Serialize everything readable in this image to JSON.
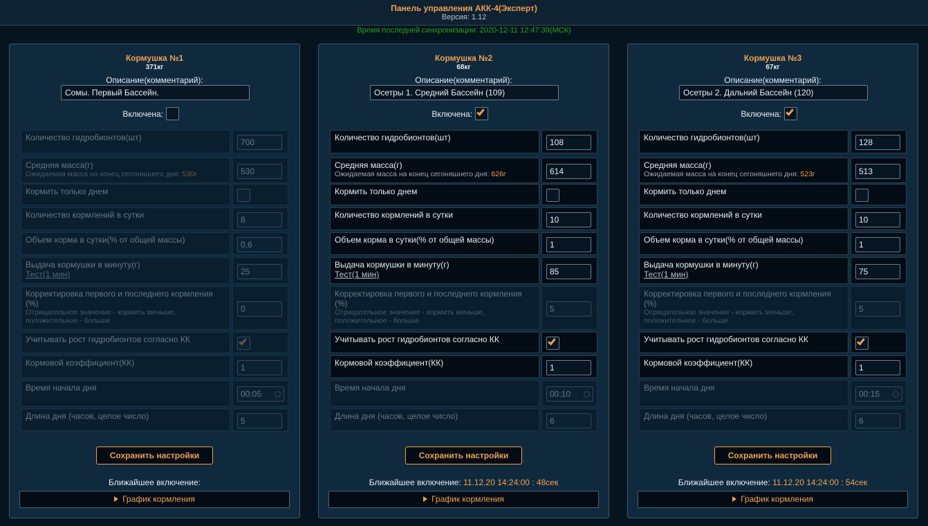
{
  "header": {
    "title": "Панель управления АКК-4(Эксперт)",
    "version": "Версия: 1.12",
    "sync": "Время последней синхронизации: 2020-12-11 12:47:39(МСК)"
  },
  "labels": {
    "description": "Описание(комментарий):",
    "enabled": "Включена:",
    "count": "Количество гидробионтов(шт)",
    "avg_mass": "Средняя масса(г)",
    "expected_mass": "Ожидаемая масса на конец сегоняшнего дня:",
    "day_only": "Кормить только днем",
    "feedings_per_day": "Количество кормлений в сутки",
    "feed_volume": "Объем корма в сутки(% от общей массы)",
    "output_per_minute": "Выдача кормушки в минуту(г)",
    "test_link": "Тест(1 мин)",
    "correction": "Корректировка первого и последнего кормления (%)",
    "correction_note": "Отрицательное значение - кормить меньше, положительное - больше",
    "growth": "Учитывать рост гидробионтов согласно КК",
    "feed_coef": "Кормовой коэффициент(КК)",
    "day_start": "Время начала дня",
    "day_length": "Длина дня (часов, целое число)",
    "save": "Сохранить настройки",
    "next_on": "Ближайшее включение:",
    "schedule": "График кормления"
  },
  "feeders": [
    {
      "name": "Кормушка №1",
      "mass": "371кг",
      "description": "Сомы. Первый Бассейн.",
      "enabled": false,
      "count": "700",
      "avg_mass": "530",
      "expected_mass": "530г",
      "day_only": false,
      "feedings_per_day": "8",
      "feed_volume": "0,6",
      "output_per_minute": "25",
      "correction": "0",
      "growth": true,
      "feed_coef": "1",
      "day_start": "00:05",
      "day_length": "5",
      "next_on": ""
    },
    {
      "name": "Кормушка №2",
      "mass": "68кг",
      "description": "Осетры 1. Средний Бассейн (109)",
      "enabled": true,
      "count": "108",
      "avg_mass": "614",
      "expected_mass": "626г",
      "day_only": false,
      "feedings_per_day": "10",
      "feed_volume": "1",
      "output_per_minute": "85",
      "correction": "5",
      "growth": true,
      "feed_coef": "1",
      "day_start": "00:10",
      "day_length": "6",
      "next_on": "11.12.20 14:24:00 : 48сек"
    },
    {
      "name": "Кормушка №3",
      "mass": "67кг",
      "description": "Осетры 2. Дальний Бассейн (120)",
      "enabled": true,
      "count": "128",
      "avg_mass": "513",
      "expected_mass": "523г",
      "day_only": false,
      "feedings_per_day": "10",
      "feed_volume": "1",
      "output_per_minute": "75",
      "correction": "5",
      "growth": true,
      "feed_coef": "1",
      "day_start": "00:15",
      "day_length": "6",
      "next_on": "11.12.20 14:24:00 : 54сек"
    }
  ],
  "colors": {
    "accent": "#f0a050",
    "background": "#06141f",
    "panel": "#0f2a3d",
    "sync_text": "#22a022"
  }
}
